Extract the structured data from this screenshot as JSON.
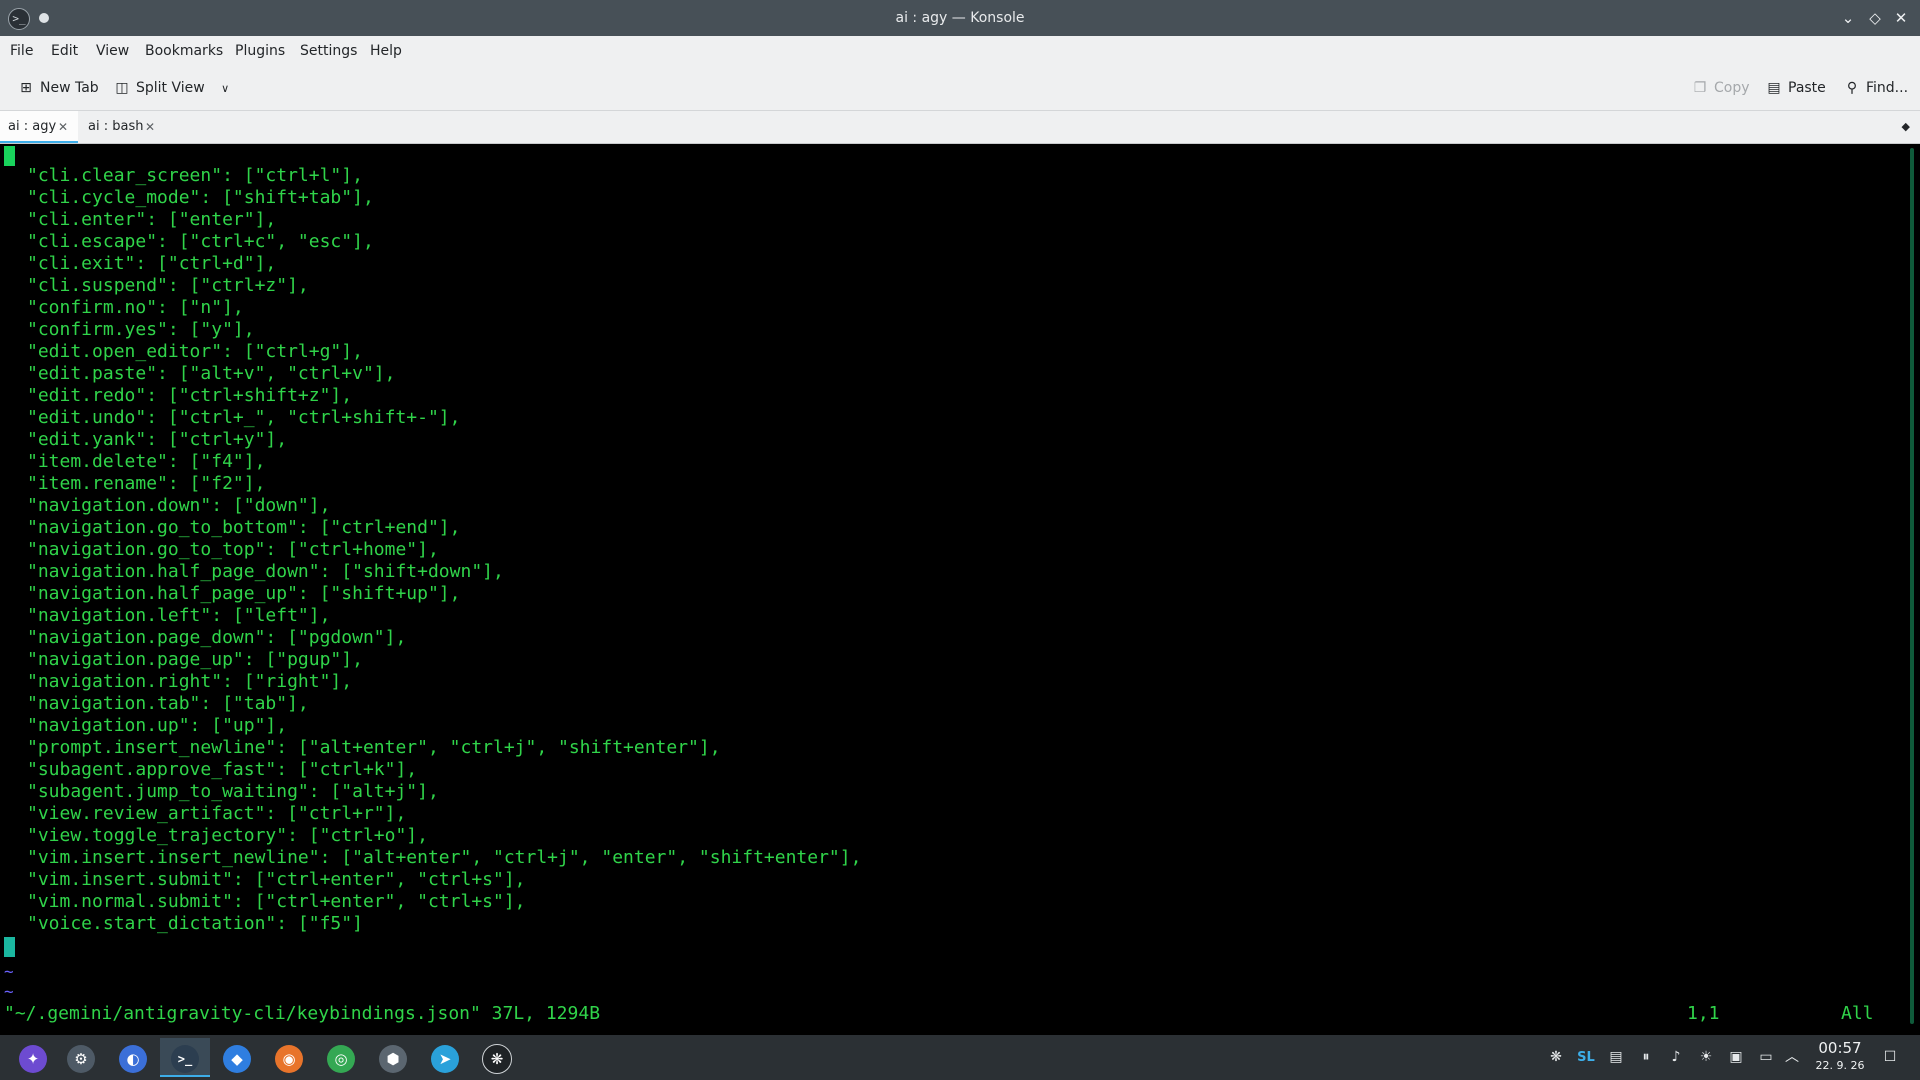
{
  "window": {
    "title": "ai : agy — Konsole",
    "app_icon_glyph": ">_"
  },
  "window_controls": {
    "minimize": "⌄",
    "maximize": "◇",
    "close": "✕"
  },
  "menu": [
    "File",
    "Edit",
    "View",
    "Bookmarks",
    "Plugins",
    "Settings",
    "Help"
  ],
  "toolbar": {
    "new_tab": "New Tab",
    "split_view": "Split View",
    "copy": "Copy",
    "paste": "Paste",
    "find": "Find..."
  },
  "tabs": [
    {
      "label": "ai : agy",
      "active": true
    },
    {
      "label": "ai : bash",
      "active": false
    }
  ],
  "terminal": {
    "lines": [
      "\"cli.clear_screen\": [\"ctrl+l\"],",
      "\"cli.cycle_mode\": [\"shift+tab\"],",
      "\"cli.enter\": [\"enter\"],",
      "\"cli.escape\": [\"ctrl+c\", \"esc\"],",
      "\"cli.exit\": [\"ctrl+d\"],",
      "\"cli.suspend\": [\"ctrl+z\"],",
      "\"confirm.no\": [\"n\"],",
      "\"confirm.yes\": [\"y\"],",
      "\"edit.open_editor\": [\"ctrl+g\"],",
      "\"edit.paste\": [\"alt+v\", \"ctrl+v\"],",
      "\"edit.redo\": [\"ctrl+shift+z\"],",
      "\"edit.undo\": [\"ctrl+_\", \"ctrl+shift+-\"],",
      "\"edit.yank\": [\"ctrl+y\"],",
      "\"item.delete\": [\"f4\"],",
      "\"item.rename\": [\"f2\"],",
      "\"navigation.down\": [\"down\"],",
      "\"navigation.go_to_bottom\": [\"ctrl+end\"],",
      "\"navigation.go_to_top\": [\"ctrl+home\"],",
      "\"navigation.half_page_down\": [\"shift+down\"],",
      "\"navigation.half_page_up\": [\"shift+up\"],",
      "\"navigation.left\": [\"left\"],",
      "\"navigation.page_down\": [\"pgdown\"],",
      "\"navigation.page_up\": [\"pgup\"],",
      "\"navigation.right\": [\"right\"],",
      "\"navigation.tab\": [\"tab\"],",
      "\"navigation.up\": [\"up\"],",
      "\"prompt.insert_newline\": [\"alt+enter\", \"ctrl+j\", \"shift+enter\"],",
      "\"subagent.approve_fast\": [\"ctrl+k\"],",
      "\"subagent.jump_to_waiting\": [\"alt+j\"],",
      "\"view.review_artifact\": [\"ctrl+r\"],",
      "\"view.toggle_trajectory\": [\"ctrl+o\"],",
      "\"vim.insert.insert_newline\": [\"alt+enter\", \"ctrl+j\", \"enter\", \"shift+enter\"],",
      "\"vim.insert.submit\": [\"ctrl+enter\", \"ctrl+s\"],",
      "\"vim.normal.submit\": [\"ctrl+enter\", \"ctrl+s\"],",
      "\"voice.start_dictation\": [\"f5\"]"
    ],
    "tilde": "~",
    "status_file": "\"~/.gemini/antigravity-cli/keybindings.json\" 37L, 1294B",
    "status_position": "1,1",
    "status_scroll": "All"
  },
  "taskbar": {
    "apps": [
      {
        "name": "app-launcher",
        "color": "#6d4bd1",
        "glyph": "✦"
      },
      {
        "name": "system-settings",
        "color": "#4e5a66",
        "glyph": "⚙"
      },
      {
        "name": "browser",
        "color": "#3b6fd8",
        "glyph": "◐"
      },
      {
        "name": "konsole",
        "color": "#2c3e50",
        "glyph": ">_",
        "active": true
      },
      {
        "name": "dolphin",
        "color": "#2f7ee0",
        "glyph": "◆"
      },
      {
        "name": "firefox",
        "color": "#e8742b",
        "glyph": "◉"
      },
      {
        "name": "chrome",
        "color": "#34a853",
        "glyph": "◎"
      },
      {
        "name": "steam",
        "color": "#5b6670",
        "glyph": "⬢"
      },
      {
        "name": "telegram",
        "color": "#2aa1da",
        "glyph": "➤"
      },
      {
        "name": "chatgpt",
        "color": "#1f2326",
        "glyph": "❋"
      }
    ],
    "tray": {
      "kbd_layout": "SL",
      "time": "00:57",
      "date": "22. 9. 26"
    }
  }
}
